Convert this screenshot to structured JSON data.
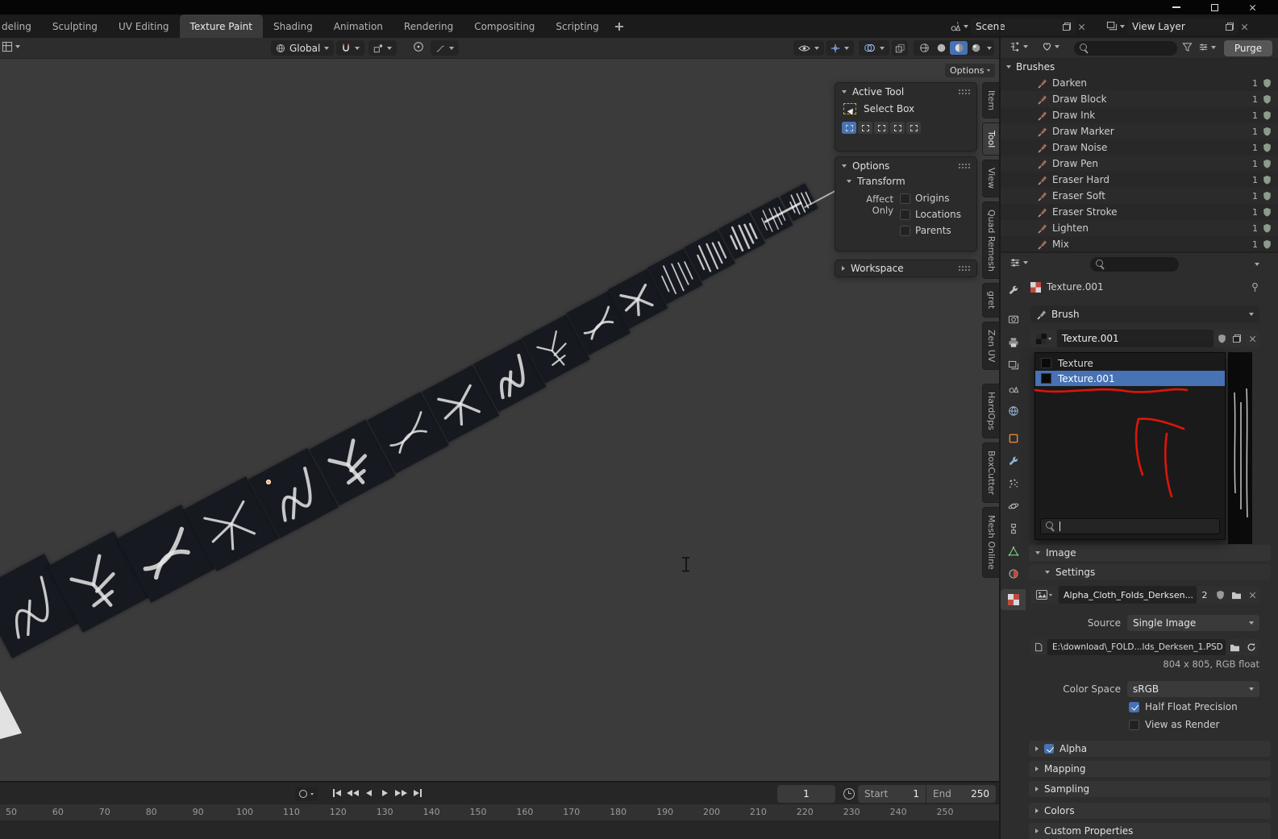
{
  "topbar": {
    "tabs": [
      {
        "label": "deling"
      },
      {
        "label": "Sculpting"
      },
      {
        "label": "UV Editing"
      },
      {
        "label": "Texture Paint"
      },
      {
        "label": "Shading"
      },
      {
        "label": "Animation"
      },
      {
        "label": "Rendering"
      },
      {
        "label": "Compositing"
      },
      {
        "label": "Scripting"
      }
    ],
    "scene_value": "Scene",
    "view_layer_value": "View Layer"
  },
  "viewport_header": {
    "orientation": "Global",
    "options_button": "Options"
  },
  "tool_panels": {
    "active_tool": {
      "title": "Active Tool",
      "tool_name": "Select Box"
    },
    "options": {
      "title": "Options",
      "transform": "Transform",
      "affect_only": "Affect Only",
      "checkboxes": [
        {
          "label": "Origins",
          "checked": false
        },
        {
          "label": "Locations",
          "checked": false
        },
        {
          "label": "Parents",
          "checked": false
        }
      ]
    },
    "workspace": {
      "title": "Workspace"
    }
  },
  "sidebar_tabs": [
    {
      "label": "Item",
      "active": false
    },
    {
      "label": "Tool",
      "active": true
    },
    {
      "label": "View",
      "active": false
    },
    {
      "label": "Quad Remesh",
      "active": false
    },
    {
      "label": "gret",
      "active": false
    },
    {
      "label": "Zen UV",
      "active": false
    },
    {
      "label": "HardOps",
      "active": false
    },
    {
      "label": "BoxCutter",
      "active": false
    },
    {
      "label": "Mesh Online",
      "active": false
    }
  ],
  "outliner": {
    "purge_button": "Purge",
    "section": "Brushes",
    "items": [
      {
        "name": "Darken",
        "count": "1"
      },
      {
        "name": "Draw Block",
        "count": "1"
      },
      {
        "name": "Draw Ink",
        "count": "1"
      },
      {
        "name": "Draw Marker",
        "count": "1"
      },
      {
        "name": "Draw Noise",
        "count": "1"
      },
      {
        "name": "Draw Pen",
        "count": "1"
      },
      {
        "name": "Eraser Hard",
        "count": "1"
      },
      {
        "name": "Eraser Soft",
        "count": "1"
      },
      {
        "name": "Eraser Stroke",
        "count": "1"
      },
      {
        "name": "Lighten",
        "count": "1"
      },
      {
        "name": "Mix",
        "count": "1"
      }
    ]
  },
  "properties": {
    "breadcrumb": "Texture.001",
    "brush_selector": "Brush",
    "texture_field": "Texture.001",
    "dropdown": {
      "items": [
        {
          "label": "Texture",
          "selected": false
        },
        {
          "label": "Texture.001",
          "selected": true
        }
      ]
    },
    "image_section": "Image",
    "settings_section": "Settings",
    "image_block": {
      "name": "Alpha_Cloth_Folds_Derksen...",
      "users": "2"
    },
    "source_label": "Source",
    "source_value": "Single Image",
    "filepath": "E:\\download\\_FOLD...lds_Derksen_1.PSD",
    "resolution": "804 x 805,  RGB float",
    "color_space_label": "Color Space",
    "color_space_value": "sRGB",
    "half_float": {
      "label": "Half Float Precision",
      "checked": true
    },
    "view_as_render": {
      "label": "View as Render",
      "checked": false
    },
    "sections": [
      {
        "label": "Alpha"
      },
      {
        "label": "Mapping"
      },
      {
        "label": "Sampling"
      },
      {
        "label": "Colors"
      },
      {
        "label": "Custom Properties"
      }
    ]
  },
  "timeline": {
    "current_frame": "1",
    "start_label": "Start",
    "start_value": "1",
    "end_label": "End",
    "end_value": "250",
    "ruler": [
      "50",
      "60",
      "70",
      "80",
      "90",
      "100",
      "110",
      "120",
      "130",
      "140",
      "150",
      "160",
      "170",
      "180",
      "190",
      "200",
      "210",
      "220",
      "230",
      "240",
      "250"
    ]
  },
  "colors": {
    "accent_blue": "#4772b3",
    "annotation_red": "#e8150a",
    "object_orange": "#e0883c"
  }
}
